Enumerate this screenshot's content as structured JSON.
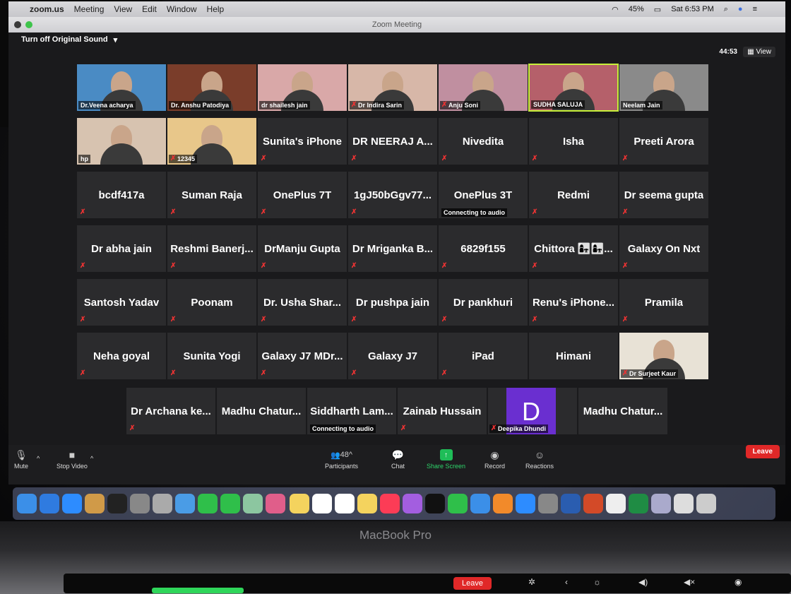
{
  "menubar": {
    "app": "zoom.us",
    "items": [
      "Meeting",
      "View",
      "Edit",
      "Window",
      "Help"
    ],
    "battery": "45%",
    "clock": "Sat 6:53 PM"
  },
  "window": {
    "title": "Zoom Meeting"
  },
  "top": {
    "original_sound": "Turn off Original Sound",
    "timer": "44:53",
    "view": "View"
  },
  "rows": [
    [
      {
        "label": "Dr.Veena acharya",
        "video": true,
        "color": "#4a8bc4"
      },
      {
        "label": "Dr. Anshu Patodiya",
        "video": true,
        "color": "#7a3d2a"
      },
      {
        "label": "dr shailesh jain",
        "video": true,
        "color": "#d9a8a8"
      },
      {
        "label": "Dr Indira Sarin",
        "video": true,
        "muted": true,
        "color": "#d7b7a8"
      },
      {
        "label": "Anju Soni",
        "video": true,
        "muted": true,
        "color": "#c08fa0"
      },
      {
        "label": "SUDHA SALUJA",
        "video": true,
        "active": true,
        "color": "#b5606a"
      },
      {
        "label": "Neelam Jain",
        "video": true,
        "color": "#8a8a8a"
      }
    ],
    [
      {
        "label": "hp",
        "video": true,
        "color": "#d7c3b0"
      },
      {
        "label": "12345",
        "video": true,
        "muted": true,
        "color": "#e8c78a"
      },
      {
        "label": "Sunita's iPhone",
        "muted": true
      },
      {
        "label": "DR NEERAJ A...",
        "muted": true
      },
      {
        "label": "Nivedita",
        "muted": true
      },
      {
        "label": "Isha",
        "muted": true
      },
      {
        "label": "Preeti Arora",
        "muted": true
      }
    ],
    [
      {
        "label": "bcdf417a",
        "muted": true
      },
      {
        "label": "Suman Raja",
        "muted": true
      },
      {
        "label": "OnePlus 7T",
        "muted": true
      },
      {
        "label": "1gJ50bGgv77...",
        "muted": true
      },
      {
        "label": "OnePlus 3T",
        "connecting": "Connecting to audio"
      },
      {
        "label": "Redmi",
        "muted": true
      },
      {
        "label": "Dr seema gupta",
        "muted": true
      }
    ],
    [
      {
        "label": "Dr abha jain",
        "muted": true
      },
      {
        "label": "Reshmi Banerj...",
        "muted": true
      },
      {
        "label": "DrManju Gupta",
        "muted": true
      },
      {
        "label": "Dr Mriganka B...",
        "muted": true
      },
      {
        "label": "6829f155",
        "muted": true
      },
      {
        "label": "Chittora 👩‍👧👩‍👧...",
        "muted": true
      },
      {
        "label": "Galaxy On Nxt",
        "muted": true
      }
    ],
    [
      {
        "label": "Santosh Yadav",
        "muted": true
      },
      {
        "label": "Poonam",
        "muted": true
      },
      {
        "label": "Dr. Usha Shar...",
        "muted": true
      },
      {
        "label": "Dr pushpa jain",
        "muted": true
      },
      {
        "label": "Dr pankhuri",
        "muted": true
      },
      {
        "label": "Renu's iPhone...",
        "muted": true
      },
      {
        "label": "Pramila",
        "muted": true
      }
    ],
    [
      {
        "label": "Neha goyal",
        "muted": true
      },
      {
        "label": "Sunita Yogi",
        "muted": true
      },
      {
        "label": "Galaxy J7 MDr...",
        "muted": true
      },
      {
        "label": "Galaxy J7",
        "muted": true
      },
      {
        "label": "iPad",
        "muted": true
      },
      {
        "label": "Himani"
      },
      {
        "label": "Dr Surjeet Kaur",
        "video": true,
        "muted": true,
        "color": "#e8e2d6"
      }
    ],
    [
      {
        "label": "Dr Archana ke...",
        "muted": true
      },
      {
        "label": "Madhu Chatur..."
      },
      {
        "label": "Siddharth Lam...",
        "connecting": "Connecting to audio"
      },
      {
        "label": "Zainab Hussain",
        "muted": true
      },
      {
        "label": "Deepika Dhundi",
        "avatar": "D",
        "muted": true
      },
      {
        "label": "Madhu Chatur..."
      }
    ]
  ],
  "toolbar": {
    "mute": "Mute",
    "stop_video": "Stop Video",
    "participants": "Participants",
    "participants_count": "48",
    "chat": "Chat",
    "share": "Share Screen",
    "record": "Record",
    "reactions": "Reactions",
    "leave": "Leave"
  },
  "dock": [
    "finder",
    "safari",
    "zoom",
    "preview",
    "terminal",
    "rocket",
    "launchpad",
    "mail-icon",
    "facetime",
    "messages",
    "maps",
    "photos",
    "notes",
    "calendar",
    "reminders",
    "stickies",
    "music",
    "podcasts",
    "tv",
    "numbers",
    "keynote",
    "pages",
    "appstore",
    "prefs",
    "word",
    "powerpoint",
    "chrome",
    "excel",
    "preview2",
    "textedit",
    "trash"
  ],
  "dock_colors": [
    "#3b8fe8",
    "#2f7be0",
    "#2d8cff",
    "#d09a48",
    "#222",
    "#888",
    "#aaa",
    "#4a9ce6",
    "#2fbf4a",
    "#2fbf4a",
    "#8cc6a0",
    "#e05e8a",
    "#f4d35e",
    "#fff",
    "#fff",
    "#f4d35e",
    "#fc3c56",
    "#a35ee0",
    "#111",
    "#2fbf4a",
    "#3b8fe8",
    "#f28a2a",
    "#2d8cff",
    "#888",
    "#2a5db0",
    "#d34a28",
    "#eee",
    "#1f8c44",
    "#aac",
    "#ddd",
    "#ccc"
  ],
  "laptop": {
    "model": "MacBook Pro",
    "touchbar_leave": "Leave"
  }
}
